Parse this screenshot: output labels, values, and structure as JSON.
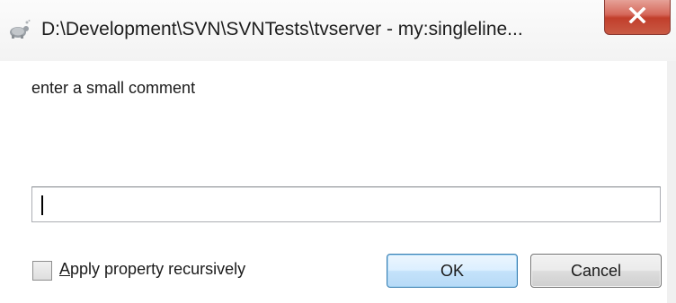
{
  "window": {
    "title": "D:\\Development\\SVN\\SVNTests\\tvserver - my:singleline...",
    "app_icon": "tortoise-icon",
    "close_icon": "close-icon"
  },
  "dialog": {
    "prompt": "enter a small comment",
    "input_value": "",
    "checkbox": {
      "mnemonic": "A",
      "label_rest": "pply property recursively",
      "checked": false
    },
    "ok_label": "OK",
    "cancel_label": "Cancel"
  },
  "colors": {
    "close_button": "#c13e2b",
    "default_button_border": "#3c7fb1"
  }
}
